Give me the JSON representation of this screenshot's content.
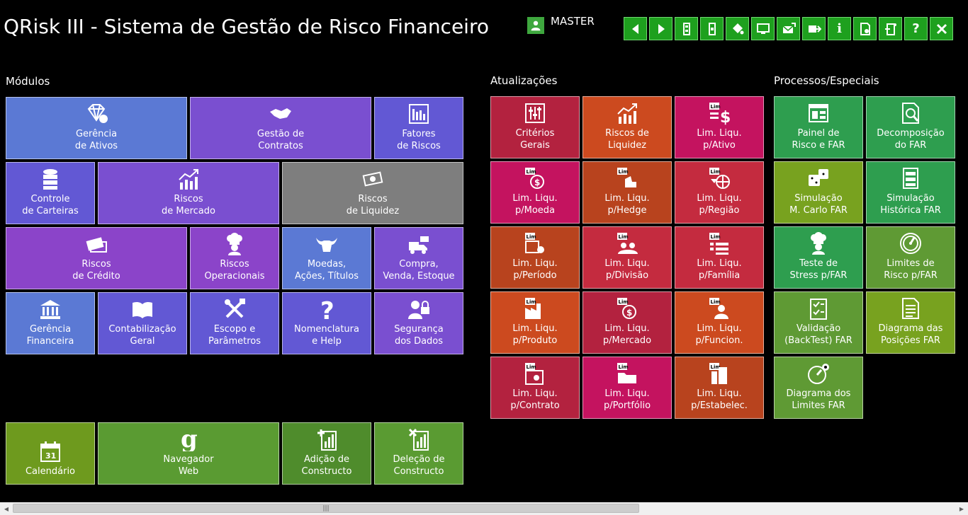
{
  "app": {
    "title": "QRisk III - Sistema de Gestão de Risco Financeiro",
    "user": "MASTER"
  },
  "toolbar": [
    "left",
    "right",
    "db",
    "db2",
    "paint",
    "monitor",
    "mail",
    "export",
    "info",
    "doc",
    "exit-doc",
    "help",
    "close"
  ],
  "sections": {
    "modulos": "Módulos",
    "atualizacoes": "Atualizações",
    "processos": "Processos/Especiais"
  },
  "colors": {
    "blue": "#5b79d4",
    "violet": "#7a4fd0",
    "purple": "#8b44c9",
    "indigo": "#6258d4",
    "gray": "#7e7e7e",
    "crimson": "#b3223f",
    "orange": "#cc4a1f",
    "magenta": "#c4135f",
    "rust": "#b8431e",
    "red": "#c42b3f",
    "green": "#2e9e4f",
    "olive": "#78a21f",
    "lime": "#5f9a34"
  },
  "modules": [
    {
      "label": "Gerência\nde Ativos",
      "icon": "diamond",
      "c": "blue"
    },
    {
      "label": "Gestão de\nContratos",
      "icon": "handshake",
      "c": "violet"
    },
    {
      "label": "Fatores\nde  Riscos",
      "icon": "bars",
      "c": "indigo"
    },
    {
      "label": "Controle\nde Carteiras",
      "icon": "database",
      "c": "indigo"
    },
    {
      "label": "Riscos\nde  Mercado",
      "icon": "chart-up",
      "c": "violet"
    },
    {
      "label": "Riscos\nde Liquidez",
      "icon": "money",
      "c": "gray"
    },
    {
      "label": "Riscos\nde  Crédito",
      "icon": "cards",
      "c": "purple"
    },
    {
      "label": "Riscos\nOperacionais",
      "icon": "chef",
      "c": "purple"
    },
    {
      "label": "Moedas,\nAções, Títulos",
      "icon": "bull",
      "c": "blue"
    },
    {
      "label": "Compra,\nVenda, Estoque",
      "icon": "truck",
      "c": "violet"
    },
    {
      "label": "Gerência\nFinanceira",
      "icon": "bank",
      "c": "blue"
    },
    {
      "label": "Contabilização\nGeral",
      "icon": "book",
      "c": "indigo"
    },
    {
      "label": "Escopo e\nParâmetros",
      "icon": "tools",
      "c": "indigo"
    },
    {
      "label": "Nomenclatura\ne Help",
      "icon": "question",
      "c": "indigo"
    },
    {
      "label": "Segurança\ndos Dados",
      "icon": "lock-user",
      "c": "violet"
    }
  ],
  "bottom": [
    {
      "label": "Calendário",
      "icon": "calendar"
    },
    {
      "label": "Navegador\nWeb",
      "icon": "google"
    },
    {
      "label": "Adição de\nConstructo",
      "icon": "add-chart"
    },
    {
      "label": "Deleção de\nConstructo",
      "icon": "del-chart"
    }
  ],
  "updates": [
    {
      "label": "Critérios\nGerais",
      "icon": "sliders",
      "c": "crimson"
    },
    {
      "label": "Riscos de\nLiquidez",
      "icon": "chart-up",
      "c": "orange"
    },
    {
      "label": "Lim. Liqu.\np/Ativo",
      "icon": "lim-dollar",
      "c": "magenta"
    },
    {
      "label": "Lim. Liqu.\np/Moeda",
      "icon": "lim-coin",
      "c": "magenta"
    },
    {
      "label": "Lim. Liqu.\np/Hedge",
      "icon": "lim-chair",
      "c": "rust"
    },
    {
      "label": "Lim. Liqu.\np/Região",
      "icon": "lim-globe",
      "c": "red"
    },
    {
      "label": "Lim. Liqu.\np/Período",
      "icon": "lim-cal",
      "c": "rust"
    },
    {
      "label": "Lim. Liqu.\np/Divisão",
      "icon": "lim-people",
      "c": "red"
    },
    {
      "label": "Lim. Liqu.\np/Família",
      "icon": "lim-list",
      "c": "red"
    },
    {
      "label": "Lim. Liqu.\np/Produto",
      "icon": "lim-factory",
      "c": "orange"
    },
    {
      "label": "Lim. Liqu.\np/Mercado",
      "icon": "lim-coin",
      "c": "crimson"
    },
    {
      "label": "Lim. Liqu.\np/Funcion.",
      "icon": "lim-person",
      "c": "orange"
    },
    {
      "label": "Lim. Liqu.\np/Contrato",
      "icon": "lim-cert",
      "c": "crimson"
    },
    {
      "label": "Lim. Liqu.\np/Portfólio",
      "icon": "lim-folder",
      "c": "magenta"
    },
    {
      "label": "Lim. Liqu.\np/Estabelec.",
      "icon": "lim-building",
      "c": "rust"
    }
  ],
  "processes": [
    {
      "label": "Painel de\nRisco e FAR",
      "icon": "panel",
      "c": "green"
    },
    {
      "label": "Decomposição\ndo FAR",
      "icon": "doc-search",
      "c": "green"
    },
    {
      "label": "Simulação\nM. Carlo FAR",
      "icon": "dice",
      "c": "olive"
    },
    {
      "label": "Simulação\nHistórica FAR",
      "icon": "cabinet",
      "c": "green"
    },
    {
      "label": "Teste de\nStress p/FAR",
      "icon": "chef",
      "c": "green"
    },
    {
      "label": "Limites de\nRisco p/FAR",
      "icon": "gauge",
      "c": "lime"
    },
    {
      "label": "Validação\n(BackTest) FAR",
      "icon": "checklist",
      "c": "lime"
    },
    {
      "label": "Diagrama das\nPosições FAR",
      "icon": "doc-lines",
      "c": "olive"
    },
    {
      "label": "Diagrama dos\nLimites FAR",
      "icon": "gauge-gear",
      "c": "lime"
    }
  ]
}
